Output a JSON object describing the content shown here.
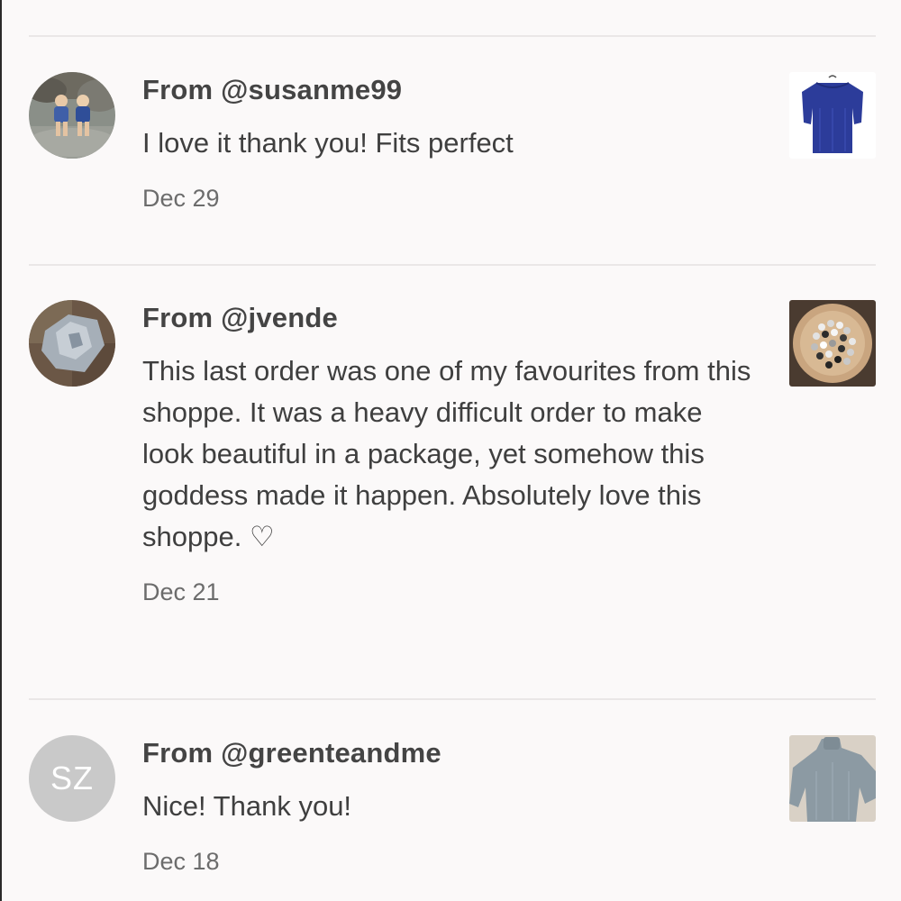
{
  "reviews": [
    {
      "from": "From @susanme99",
      "text": "I love it thank you! Fits perfect",
      "date": "Dec 29",
      "avatar": "photo-avatar",
      "thumbnail": "blue-blouse-thumbnail"
    },
    {
      "from": "From @jvende",
      "text": "This last order was one of my favourites from this shoppe. It was a heavy difficult order to make look beautiful in a package, yet somehow this goddess made it happen. Absolutely love this shoppe. ♡",
      "date": "Dec 21",
      "avatar": "photo-avatar",
      "thumbnail": "stones-bowl-thumbnail"
    },
    {
      "from": "From @greenteandme",
      "text": "Nice! Thank you!",
      "date": "Dec 18",
      "avatar_initials": "SZ",
      "thumbnail": "gray-sweater-thumbnail"
    }
  ],
  "colors": {
    "background": "#fbf9f9",
    "divider": "#eae7e7",
    "initials_avatar": "#c9c9c9"
  }
}
